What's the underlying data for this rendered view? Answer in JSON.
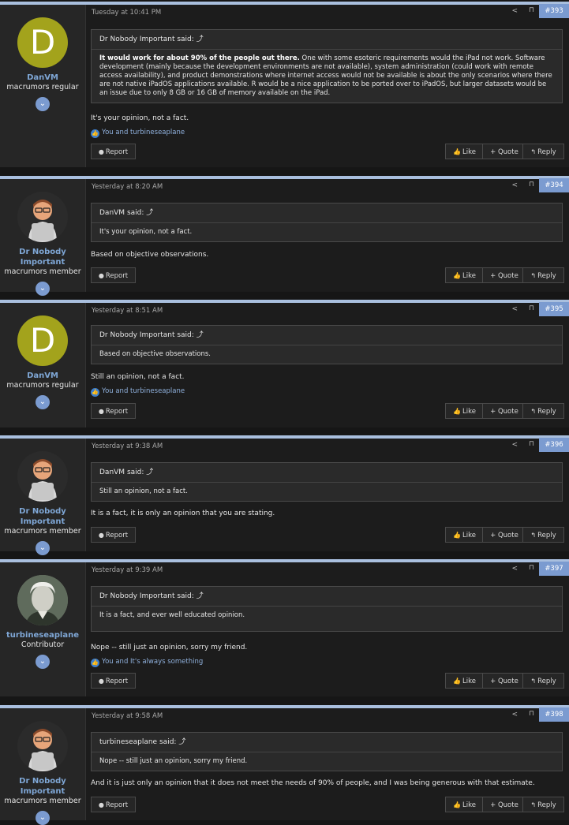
{
  "labels": {
    "report": "Report",
    "like": "Like",
    "quote": "+ Quote",
    "reply": "Reply",
    "said_suffix": "said:"
  },
  "posts": [
    {
      "author": "DanVM",
      "author_title": "macrumors regular",
      "avatar_letter": "D",
      "time": "Tuesday at 10:41 PM",
      "number": "#393",
      "quote_author": "Dr Nobody Important",
      "quote_bold": "It would work for about 90% of the people out there.",
      "quote_text": " One with some esoteric requirements would the iPad not work. Software development (mainly because the development environments are not available), system administration (could work with remote access availability), and product demonstrations where internet access would not be available is about the only scenarios where there are not native iPadOS applications available. R would be a nice application to be ported over to iPadOS, but larger datasets would be an issue due to only 8 GB or 16 GB of memory available on the iPad.",
      "body": "It's your opinion, not a fact.",
      "reactions": "You and turbineseaplane",
      "liked": true
    },
    {
      "author": "Dr Nobody Important",
      "author_title": "macrumors member",
      "time": "Yesterday at 8:20 AM",
      "number": "#394",
      "quote_author": "DanVM",
      "quote_text": "It's your opinion, not a fact.",
      "body": "Based on objective observations.",
      "liked": false
    },
    {
      "author": "DanVM",
      "author_title": "macrumors regular",
      "avatar_letter": "D",
      "time": "Yesterday at 8:51 AM",
      "number": "#395",
      "quote_author": "Dr Nobody Important",
      "quote_text": "Based on objective observations.",
      "body": "Still an opinion, not a fact.",
      "reactions": "You and turbineseaplane",
      "liked": true
    },
    {
      "author": "Dr Nobody Important",
      "author_title": "macrumors member",
      "time": "Yesterday at 9:38 AM",
      "number": "#396",
      "quote_author": "DanVM",
      "quote_text": "Still an opinion, not a fact.",
      "body": "It is a fact, it is only an opinion that you are stating.",
      "liked": false
    },
    {
      "author": "turbineseaplane",
      "author_title": "Contributor",
      "time": "Yesterday at 9:39 AM",
      "number": "#397",
      "quote_author": "Dr Nobody Important",
      "quote_text": "It is a fact, and ever well educated opinion.",
      "body": "Nope -- still just an opinion, sorry my friend.",
      "reactions": "You and It's always something",
      "liked": true
    },
    {
      "author": "Dr Nobody Important",
      "author_title": "macrumors member",
      "time": "Yesterday at 9:58 AM",
      "number": "#398",
      "quote_author": "turbineseaplane",
      "quote_text": "Nope -- still just an opinion, sorry my friend.",
      "body": "And it is just only an opinion that it does not meet the needs of 90% of people, and I was being generous with that estimate.",
      "liked": false
    }
  ],
  "colors": {
    "accent": "#7b9bd0",
    "link": "#7fa7d6",
    "background": "#1c1c1c"
  },
  "icons": {
    "share": "share-icon",
    "bookmark": "bookmark-icon",
    "expand": "chevron-down-icon",
    "quote_jump": "arrow-up-icon"
  }
}
